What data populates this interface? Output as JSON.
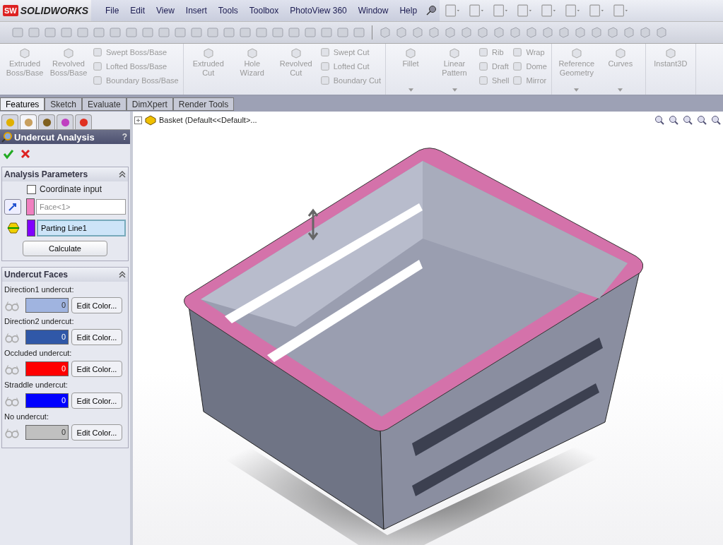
{
  "app": {
    "logo_mark": "SW",
    "logo_text": "SOLIDWORKS"
  },
  "menu": [
    "File",
    "Edit",
    "View",
    "Insert",
    "Tools",
    "Toolbox",
    "PhotoView 360",
    "Window",
    "Help"
  ],
  "ribbon": [
    {
      "items": [
        {
          "kind": "large",
          "label": "Extruded Boss/Base",
          "dropdown": false
        },
        {
          "kind": "large",
          "label": "Revolved Boss/Base",
          "dropdown": false
        },
        {
          "kind": "stack",
          "labels": [
            "Swept Boss/Base",
            "Lofted Boss/Base",
            "Boundary Boss/Base"
          ]
        }
      ]
    },
    {
      "items": [
        {
          "kind": "large",
          "label": "Extruded Cut",
          "dropdown": false
        },
        {
          "kind": "large",
          "label": "Hole Wizard",
          "dropdown": false
        },
        {
          "kind": "large",
          "label": "Revolved Cut",
          "dropdown": false
        },
        {
          "kind": "stack",
          "labels": [
            "Swept Cut",
            "Lofted Cut",
            "Boundary Cut"
          ]
        }
      ]
    },
    {
      "items": [
        {
          "kind": "large",
          "label": "Fillet",
          "dropdown": true
        },
        {
          "kind": "large",
          "label": "Linear Pattern",
          "dropdown": true
        },
        {
          "kind": "stack",
          "labels": [
            "Rib",
            "Draft",
            "Shell"
          ]
        },
        {
          "kind": "stack",
          "labels": [
            "Wrap",
            "Dome",
            "Mirror"
          ]
        }
      ]
    },
    {
      "items": [
        {
          "kind": "large",
          "label": "Reference Geometry",
          "dropdown": true
        },
        {
          "kind": "large",
          "label": "Curves",
          "dropdown": true
        }
      ]
    },
    {
      "items": [
        {
          "kind": "large",
          "label": "Instant3D",
          "dropdown": false
        }
      ]
    }
  ],
  "tabs": [
    {
      "label": "Features",
      "selected": true
    },
    {
      "label": "Sketch",
      "selected": false
    },
    {
      "label": "Evaluate",
      "selected": false
    },
    {
      "label": "DimXpert",
      "selected": false
    },
    {
      "label": "Render Tools",
      "selected": false
    }
  ],
  "manager_tabs": [
    {
      "selected": false
    },
    {
      "selected": true
    },
    {
      "selected": false
    },
    {
      "selected": false
    },
    {
      "selected": false
    }
  ],
  "panel": {
    "title": "Undercut Analysis",
    "help": "?",
    "parameters": {
      "title": "Analysis Parameters",
      "coordinate_input": {
        "label": "Coordinate input",
        "checked": false
      },
      "fields": [
        {
          "value": "Face<1>",
          "color": "#f080c0",
          "selected": false
        },
        {
          "value": "Parting Line1",
          "color": "#8000ff",
          "selected": true
        }
      ],
      "button": "Calculate"
    },
    "faces": {
      "title": "Undercut Faces",
      "rows": [
        {
          "label": "Direction1 undercut:",
          "count": "0",
          "color": "#a0b4e0",
          "button": "Edit Color..."
        },
        {
          "label": "Direction2 undercut:",
          "count": "0",
          "color": "#3058a8",
          "button": "Edit Color..."
        },
        {
          "label": "Occluded undercut:",
          "count": "0",
          "color": "#ff0000",
          "button": "Edit Color..."
        },
        {
          "label": "Straddle undercut:",
          "count": "0",
          "color": "#0000ff",
          "button": "Edit Color..."
        },
        {
          "label": "No undercut:",
          "count": "0",
          "color": "#c0c0c0",
          "button": "Edit Color..."
        }
      ]
    }
  },
  "tree": {
    "label": "Basket  (Default<<Default>..."
  }
}
